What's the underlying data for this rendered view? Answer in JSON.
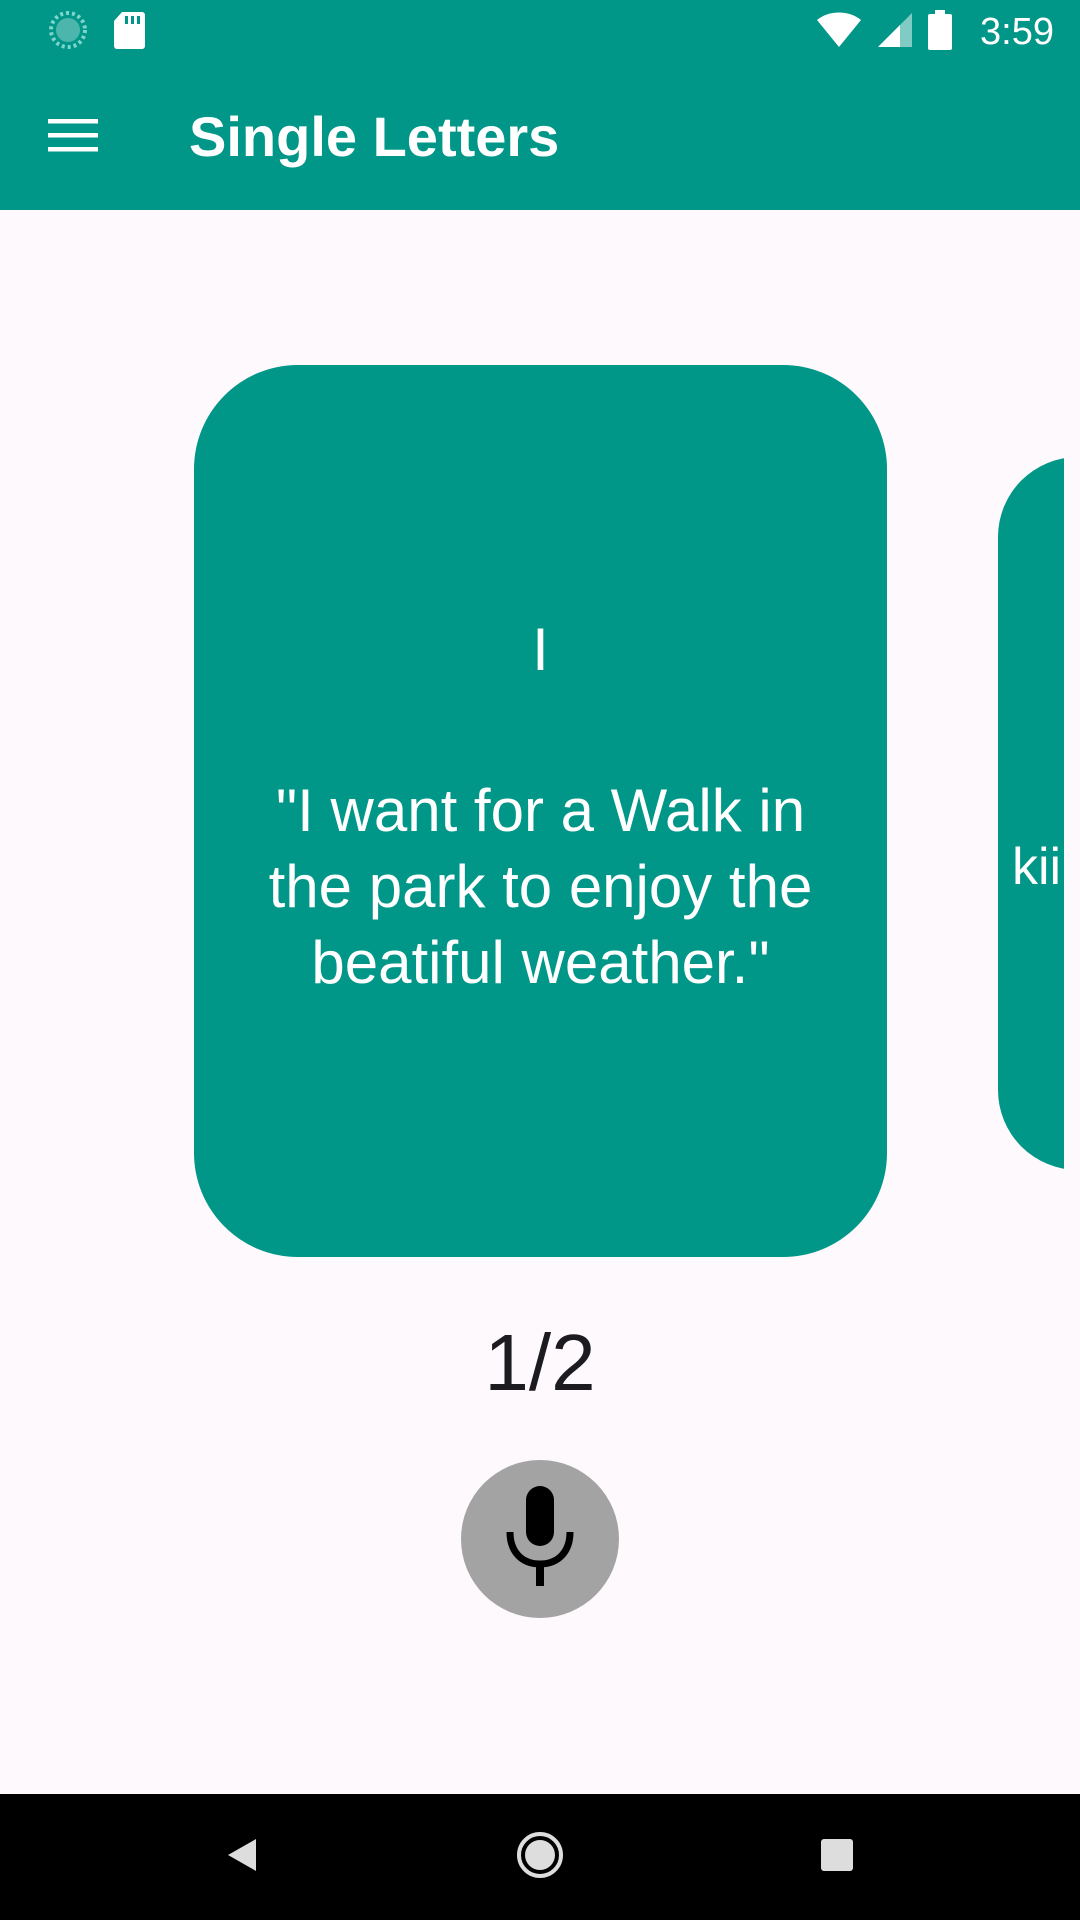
{
  "status_bar": {
    "time": "3:59",
    "left_icons": [
      "sync-icon",
      "sd-card-icon"
    ],
    "right_icons": [
      "wifi-icon",
      "cellular-signal-icon",
      "battery-icon"
    ]
  },
  "app_bar": {
    "menu_icon": "hamburger-menu-icon",
    "title": "Single Letters"
  },
  "cards": {
    "current": {
      "letter": "I",
      "sentence": "\"I want for a Walk in the park to enjoy the beatiful weather.\""
    },
    "next_peek": {
      "text": "kii"
    }
  },
  "page_indicator": "1/2",
  "mic_button": {
    "icon": "microphone-icon"
  },
  "nav_bar": {
    "buttons": [
      "back-icon",
      "home-icon",
      "recents-icon"
    ]
  },
  "colors": {
    "primary": "#009688",
    "background": "#fdf9fc",
    "mic_background": "#a3a3a3",
    "nav_bar": "#000000",
    "text_dark": "#1c1b1f",
    "text_light": "#ffffff"
  }
}
